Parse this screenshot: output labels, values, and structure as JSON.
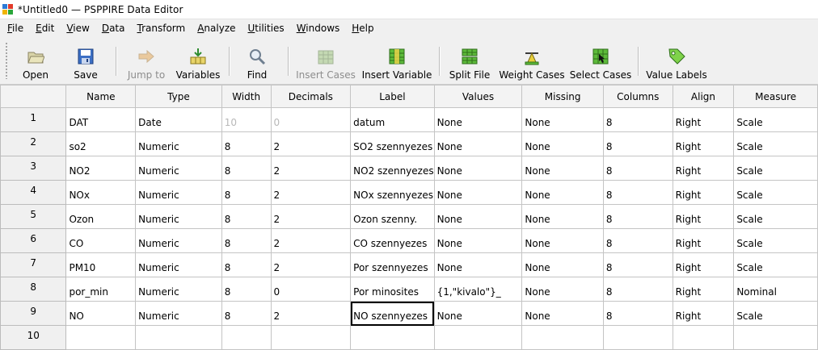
{
  "window": {
    "title": "*Untitled0 — PSPPIRE Data Editor"
  },
  "menu": [
    {
      "label": "File",
      "key": "F",
      "rest": "ile"
    },
    {
      "label": "Edit",
      "key": "E",
      "rest": "dit"
    },
    {
      "label": "View",
      "key": "V",
      "rest": "iew"
    },
    {
      "label": "Data",
      "key": "D",
      "rest": "ata"
    },
    {
      "label": "Transform",
      "key": "T",
      "rest": "ransform"
    },
    {
      "label": "Analyze",
      "key": "A",
      "rest": "nalyze"
    },
    {
      "label": "Utilities",
      "key": "U",
      "rest": "tilities"
    },
    {
      "label": "Windows",
      "key": "W",
      "rest": "indows"
    },
    {
      "label": "Help",
      "key": "H",
      "rest": "elp"
    }
  ],
  "toolbar": {
    "open": "Open",
    "save": "Save",
    "jump_to": "Jump to",
    "variables": "Variables",
    "find": "Find",
    "insert_cases": "Insert Cases",
    "insert_variable": "Insert Variable",
    "split_file": "Split File",
    "weight_cases": "Weight Cases",
    "select_cases": "Select Cases",
    "value_labels": "Value Labels"
  },
  "columns": [
    "Name",
    "Type",
    "Width",
    "Decimals",
    "Label",
    "Values",
    "Missing",
    "Columns",
    "Align",
    "Measure"
  ],
  "rows": [
    {
      "n": "1",
      "cells": [
        "DAT",
        "Date",
        "10",
        "0",
        "datum",
        "None",
        "None",
        "8",
        "Right",
        "Scale"
      ]
    },
    {
      "n": "2",
      "cells": [
        "so2",
        "Numeric",
        "8",
        "2",
        "SO2 szennyezes",
        "None",
        "None",
        "8",
        "Right",
        "Scale"
      ]
    },
    {
      "n": "3",
      "cells": [
        "NO2",
        "Numeric",
        "8",
        "2",
        "NO2 szennyezes",
        "None",
        "None",
        "8",
        "Right",
        "Scale"
      ]
    },
    {
      "n": "4",
      "cells": [
        "NOx",
        "Numeric",
        "8",
        "2",
        "NOx szennyezes",
        "None",
        "None",
        "8",
        "Right",
        "Scale"
      ]
    },
    {
      "n": "5",
      "cells": [
        "Ozon",
        "Numeric",
        "8",
        "2",
        "Ozon szenny.",
        "None",
        "None",
        "8",
        "Right",
        "Scale"
      ]
    },
    {
      "n": "6",
      "cells": [
        "CO",
        "Numeric",
        "8",
        "2",
        "CO szennyezes",
        "None",
        "None",
        "8",
        "Right",
        "Scale"
      ]
    },
    {
      "n": "7",
      "cells": [
        "PM10",
        "Numeric",
        "8",
        "2",
        "Por szennyezes",
        "None",
        "None",
        "8",
        "Right",
        "Scale"
      ]
    },
    {
      "n": "8",
      "cells": [
        "por_min",
        "Numeric",
        "8",
        "0",
        "Por minosites",
        "{1,\"kivalo\"}_",
        "None",
        "8",
        "Right",
        "Nominal"
      ]
    },
    {
      "n": "9",
      "cells": [
        "NO",
        "Numeric",
        "8",
        "2",
        "NO szennyezes",
        "None",
        "None",
        "8",
        "Right",
        "Scale"
      ]
    },
    {
      "n": "10",
      "cells": [
        "",
        "",
        "",
        "",
        "",
        "",
        "",
        "",
        "",
        ""
      ]
    }
  ]
}
